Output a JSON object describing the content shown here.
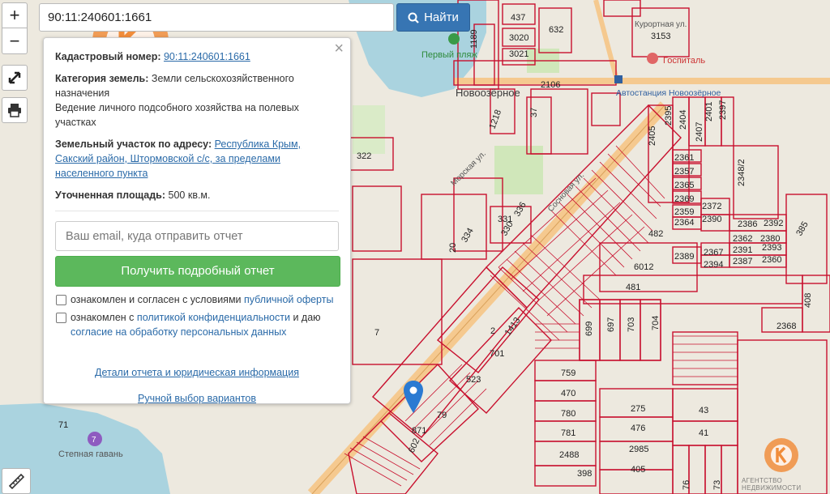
{
  "search": {
    "value": "90:11:240601:1661",
    "button_label": "Найти"
  },
  "zoom": {
    "in_label": "+",
    "out_label": "−"
  },
  "panel": {
    "cadastral_label": "Кадастровый номер:",
    "cadastral_value": "90:11:240601:1661",
    "category_label": "Категория земель:",
    "category_value": "Земли сельскохозяйственного назначения",
    "use_value": "Ведение личного подсобного хозяйства на полевых участках",
    "address_label": "Земельный участок по адресу:",
    "address_value": "Республика Крым, Сакский район, Штормовской с/с, за пределами населенного пункта",
    "area_label": "Уточненная площадь:",
    "area_value": "500 кв.м.",
    "email_placeholder": "Ваш email, куда отправить отчет",
    "report_button": "Получить подробный отчет",
    "consent1_text": "ознакомлен и согласен с условиями",
    "consent1_link": "публичной оферты",
    "consent2_text": "ознакомлен с",
    "consent2_link": "политикой конфиденциальности",
    "consent2_mid": "и даю",
    "consent2_link2": "согласие на обработку персональных данных",
    "details_link": "Детали отчета и юридическая информация",
    "manual_link": "Ручной выбор вариантов",
    "close_label": "×"
  },
  "watermark": {
    "text": "АГЕНТСТВО НЕДВИЖИМОСТИ"
  },
  "map_labels": {
    "place_novoozernoe": "Новоозёрное",
    "first_beach": "Первый пляж",
    "hospital": "Госпиталь",
    "kurortnaya": "Курортная ул.",
    "bus_station": "Автостанция Новоозёрное",
    "morskaya": "Морская ул.",
    "sosnovaya": "Сосновая ул.",
    "stepnaya_gavan": "Степная гавань",
    "stepnaya_num": "7",
    "parcels": [
      "437",
      "632",
      "3153",
      "3020",
      "3021",
      "1189",
      "2106",
      "37",
      "1218",
      "322",
      "2405",
      "2395",
      "2404",
      "2407",
      "2401",
      "2397",
      "2361",
      "2357",
      "2365",
      "2369",
      "2372",
      "2359",
      "2364",
      "2390",
      "2348/2",
      "2386",
      "2392",
      "2362",
      "2380",
      "2389",
      "2367",
      "2391",
      "2393",
      "2394",
      "2387",
      "2360",
      "385",
      "6012",
      "482",
      "481",
      "2368",
      "408",
      "331",
      "330",
      "336",
      "334",
      "20",
      "7",
      "2",
      "1413",
      "701",
      "523",
      "699",
      "697",
      "703",
      "704",
      "759",
      "470",
      "780",
      "781",
      "275",
      "476",
      "43",
      "41",
      "2488",
      "2985",
      "405",
      "398",
      "79",
      "871",
      "602",
      "71",
      "76",
      "73"
    ]
  },
  "colors": {
    "parcel_line": "#c8102e",
    "water": "#aad3df",
    "road": "#f7d4a4",
    "search_button": "#3775b3",
    "report_button": "#5cb85c"
  }
}
